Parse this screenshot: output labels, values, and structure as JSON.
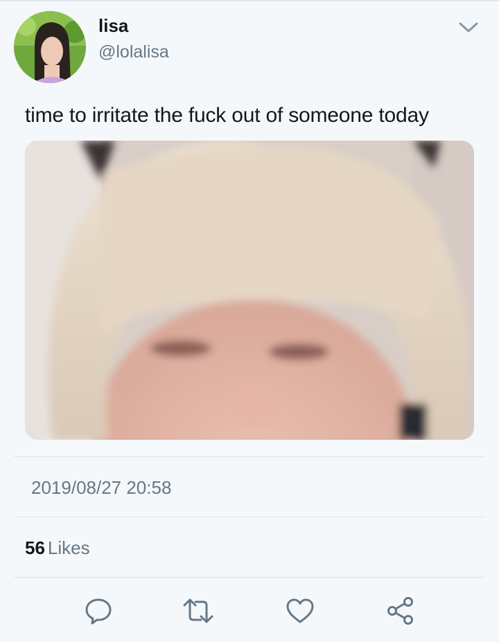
{
  "tweet": {
    "display_name": "lisa",
    "handle": "@lolalisa",
    "text": "time to irritate the fuck out of someone today",
    "timestamp": "2019/08/27 20:58",
    "likes_count": "56",
    "likes_label": "Likes"
  },
  "icons": {
    "menu": "chevron-down-icon",
    "reply": "reply-icon",
    "retweet": "retweet-icon",
    "like": "heart-icon",
    "share": "share-icon"
  },
  "colors": {
    "background": "#f5f8fa",
    "text": "#14171a",
    "secondary_text": "#657786",
    "icon": "#657786",
    "divider": "#dde3e8"
  }
}
